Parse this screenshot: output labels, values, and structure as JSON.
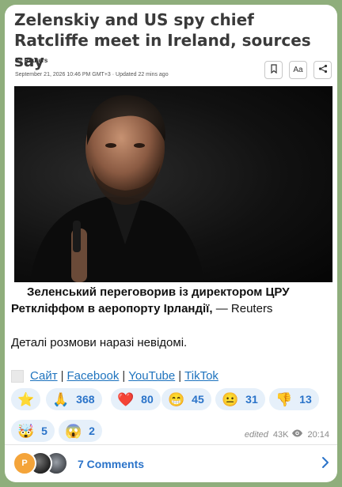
{
  "article": {
    "headline": "Zelenskiy and US spy chief Ratcliffe meet in Ireland, sources say",
    "by_prefix": "By",
    "author": "Reuters",
    "date": "September 21, 2026 10:46 PM GMT+3 · Updated 22 mins ago",
    "font_btn_label": "Aa"
  },
  "post": {
    "caption_bold": "Зеленський переговорив із директором ЦРУ Ретклiффом в аеропорту Ірландії,",
    "caption_tail": " — Reuters",
    "paragraph": "Деталі розмови наразі невідомі.",
    "links": [
      "Сайт",
      "Facebook",
      "YouTube",
      "TikTok"
    ],
    "link_separator": "|"
  },
  "reactions": [
    {
      "emoji": "⭐",
      "count": ""
    },
    {
      "emoji": "🙏",
      "count": "368"
    },
    {
      "emoji": "❤️",
      "count": "80"
    },
    {
      "emoji": "😁",
      "count": "45"
    },
    {
      "emoji": "😐",
      "count": "31"
    },
    {
      "emoji": "👎",
      "count": "13"
    },
    {
      "emoji": "🤯",
      "count": "5"
    },
    {
      "emoji": "😱",
      "count": "2"
    }
  ],
  "meta": {
    "edited": "edited",
    "views": "43K",
    "time": "20:14"
  },
  "footer": {
    "avatar_initial": "P",
    "comments_label": "7 Comments"
  },
  "colors": {
    "background": "#8fae7c",
    "link": "#1e73be",
    "accent": "#2a73c9",
    "reaction_bg": "#e6f0fa"
  }
}
